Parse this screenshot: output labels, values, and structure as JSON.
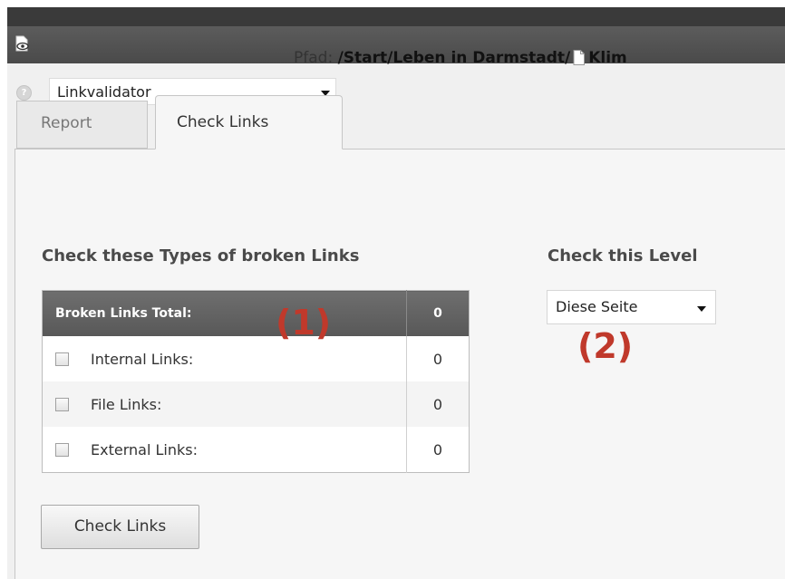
{
  "toolbar": {
    "view_icon": "view-page-icon"
  },
  "module": {
    "help_icon": "help-icon",
    "help_glyph": "?",
    "selected": "Linkvalidator"
  },
  "path": {
    "label": "Pfad:",
    "value": "/Start/Leben in Darmstadt/",
    "page_icon": "page-icon",
    "page_title": "Klim"
  },
  "tabs": [
    {
      "label": "Report",
      "active": false
    },
    {
      "label": "Check Links",
      "active": true
    }
  ],
  "types_section": {
    "heading": "Check these Types of broken Links",
    "table": {
      "header_label": "Broken Links Total:",
      "header_count": "0",
      "rows": [
        {
          "label": "Internal Links:",
          "count": "0",
          "checked": false
        },
        {
          "label": "File Links:",
          "count": "0",
          "checked": false
        },
        {
          "label": "External Links:",
          "count": "0",
          "checked": false
        }
      ]
    }
  },
  "level_section": {
    "heading": "Check this Level",
    "selected": "Diese Seite"
  },
  "annotations": {
    "one": "(1)",
    "two": "(2)",
    "color": "#c0392b"
  },
  "check_button": {
    "label": "Check Links"
  }
}
